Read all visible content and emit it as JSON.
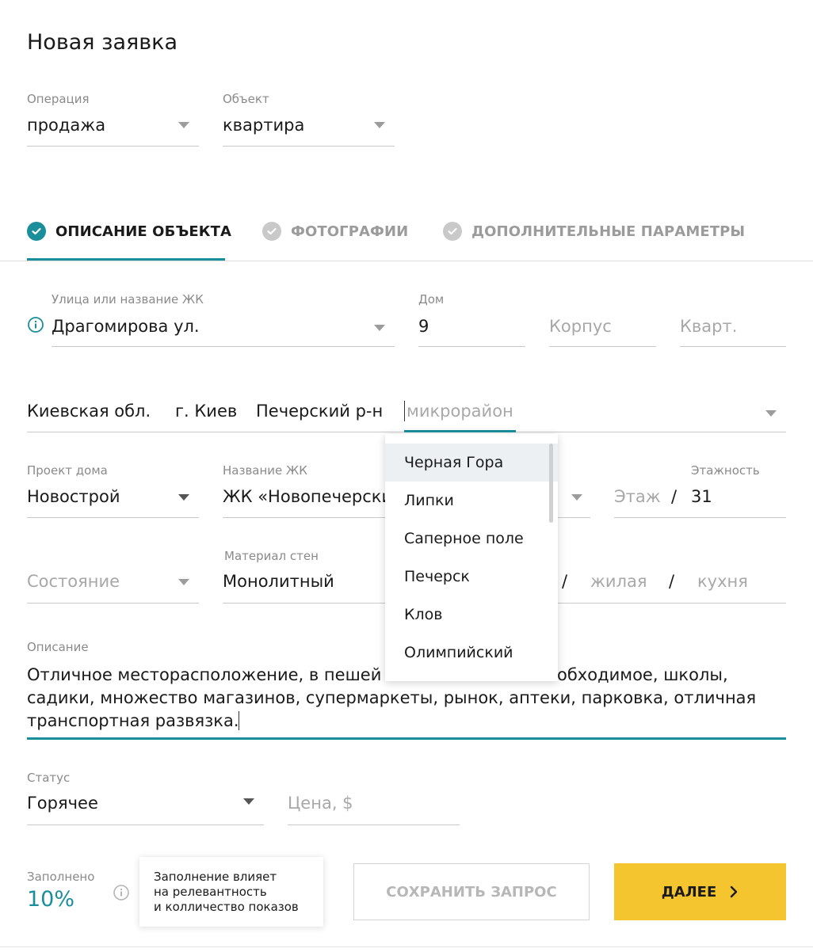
{
  "title": "Новая заявка",
  "operation": {
    "label": "Операция",
    "value": "продажа"
  },
  "object": {
    "label": "Объект",
    "value": "квартира"
  },
  "tabs": [
    {
      "label": "ОПИСАНИЕ ОБЪЕКТА",
      "active": true
    },
    {
      "label": "ФОТОГРАФИИ",
      "active": false
    },
    {
      "label": "ДОПОЛНИТЕЛЬНЫЕ ПАРАМЕТРЫ",
      "active": false
    }
  ],
  "street": {
    "label": "Улица или название ЖК",
    "value": "Драгомирова ул."
  },
  "house": {
    "label": "Дом",
    "value": "9"
  },
  "korpus": {
    "placeholder": "Корпус"
  },
  "apartment": {
    "placeholder": "Кварт."
  },
  "location": {
    "region": "Киевская обл.",
    "city": "г. Киев",
    "district": "Печерский р-н",
    "microdistrict_placeholder": "микрорайон"
  },
  "microdistrict_options": [
    "Черная Гора",
    "Липки",
    "Саперное поле",
    "Печерск",
    "Клов",
    "Олимпийский"
  ],
  "project": {
    "label": "Проект дома",
    "value": "Новострой"
  },
  "complex": {
    "label": "Название ЖК",
    "value": "ЖК «Новопечерски"
  },
  "floor": {
    "placeholder": "Этаж",
    "sep": "/"
  },
  "floors_total": {
    "label": "Этажность",
    "value": "31"
  },
  "condition": {
    "placeholder": "Состояние"
  },
  "walls": {
    "label": "Материал  стен",
    "value": "Монолитный"
  },
  "area": {
    "sep1": "/",
    "living": "жилая",
    "sep2": "/",
    "kitchen": "кухня"
  },
  "description": {
    "label": "Описание",
    "line1_a": "Отличное месторасположение, в пешей",
    "line1_b": "обходимое, школы,",
    "line2": "садики, множество магазинов, супермаркеты, рынок, аптеки, парковка, отличная",
    "line3": "транспортная развязка."
  },
  "status": {
    "label": "Статус",
    "value": "Горячее"
  },
  "price": {
    "placeholder": "Цена, $"
  },
  "filled": {
    "label": "Заполнено",
    "value": "10%"
  },
  "tooltip": {
    "line1": "Заполнение  влияет",
    "line2": "на релевантность",
    "line3": "и колличество показов"
  },
  "buttons": {
    "save": "СОХРАНИТЬ ЗАПРОС",
    "next": "ДАЛЕЕ"
  },
  "colors": {
    "accent": "#1a8f9b",
    "primary_button": "#f5c52f",
    "check_inactive": "#c9c9c9"
  }
}
